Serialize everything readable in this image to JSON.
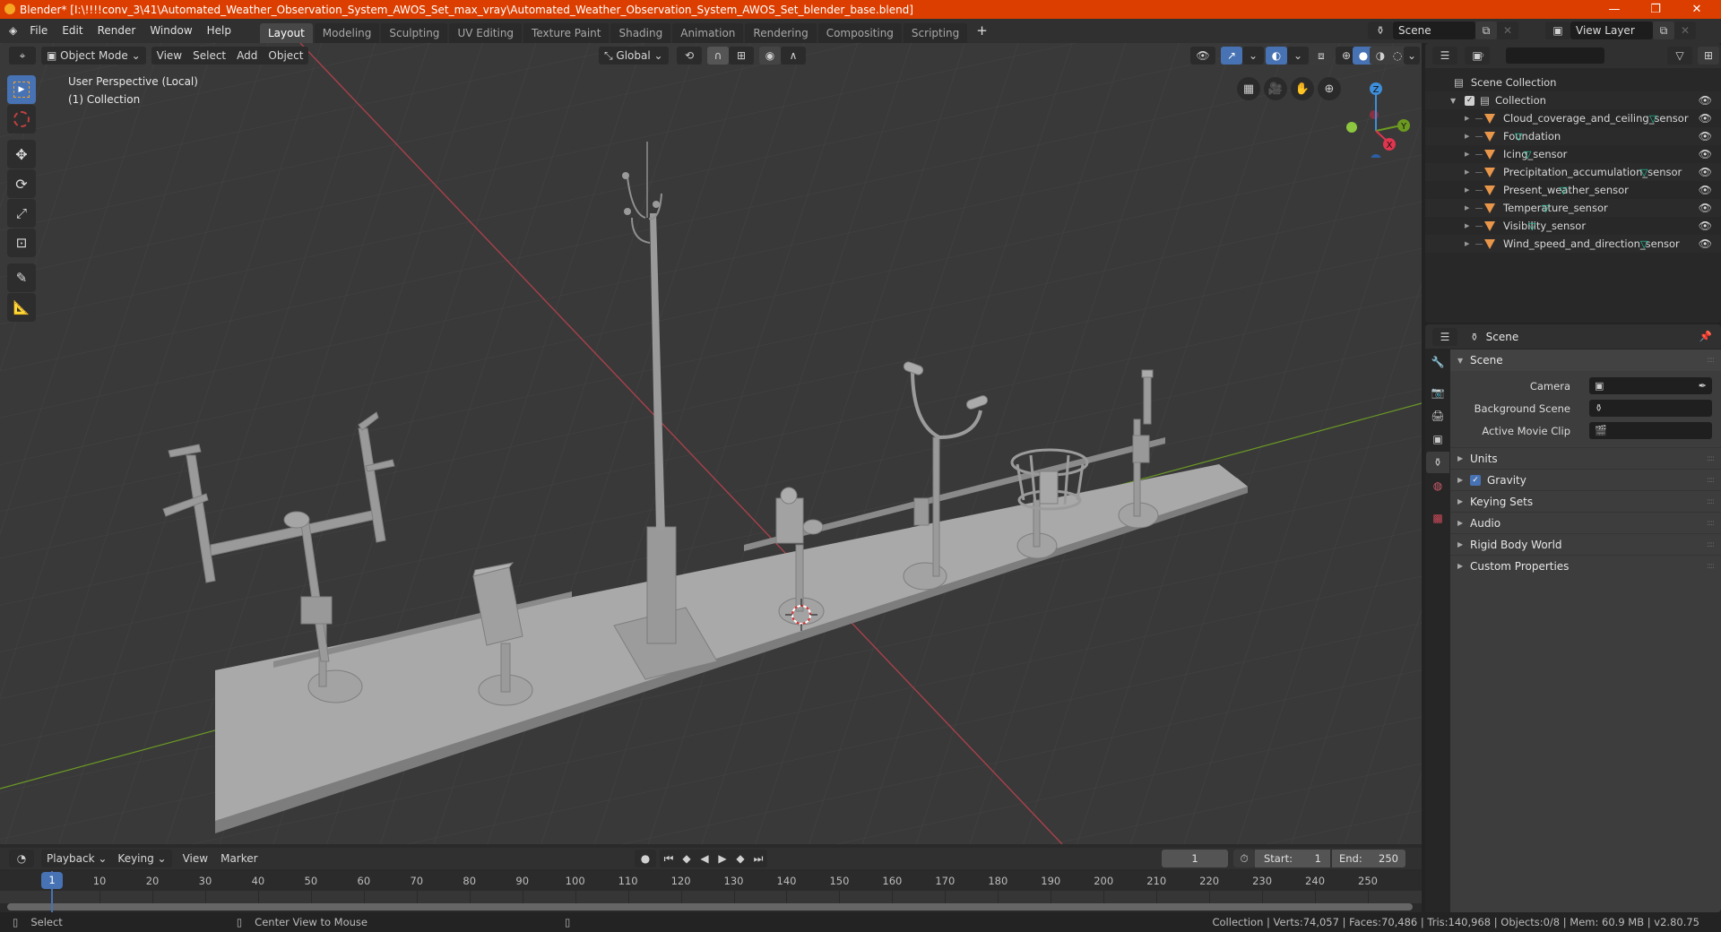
{
  "window": {
    "title": "Blender* [I:\\!!!!conv_3\\41\\Automated_Weather_Observation_System_AWOS_Set_max_vray\\Automated_Weather_Observation_System_AWOS_Set_blender_base.blend]",
    "controls": {
      "minimize": "—",
      "maximize": "❐",
      "close": "✕"
    },
    "accent_color": "#dc3e00"
  },
  "menubar": {
    "menus": [
      "File",
      "Edit",
      "Render",
      "Window",
      "Help"
    ],
    "workspaces": [
      "Layout",
      "Modeling",
      "Sculpting",
      "UV Editing",
      "Texture Paint",
      "Shading",
      "Animation",
      "Rendering",
      "Compositing",
      "Scripting"
    ],
    "active_workspace": "Layout",
    "add_workspace": "+",
    "scene": "Scene",
    "view_layer": "View Layer"
  },
  "viewport": {
    "mode": "Object Mode",
    "menus": [
      "View",
      "Select",
      "Add",
      "Object"
    ],
    "transform_orientation": "Global",
    "overlay_title": "User Perspective (Local)",
    "overlay_collection": "(1) Collection",
    "gizmo_axes": {
      "z": "Z",
      "y": "Y",
      "x": "X"
    },
    "tools": [
      "select-box",
      "cursor",
      "move",
      "rotate",
      "scale",
      "transform",
      "annotate",
      "measure"
    ],
    "active_tool": "select-box"
  },
  "outliner": {
    "search_placeholder": "",
    "root": "Scene Collection",
    "collection": "Collection",
    "collection_checked": true,
    "objects": [
      {
        "name": "Cloud_coverage_and_ceiling_sensor"
      },
      {
        "name": "Foundation"
      },
      {
        "name": "Icing_sensor"
      },
      {
        "name": "Precipitation_accumulation_sensor"
      },
      {
        "name": "Present_weather_sensor"
      },
      {
        "name": "Temperature_sensor"
      },
      {
        "name": "Visibility_sensor"
      },
      {
        "name": "Wind_speed_and_direction_sensor"
      }
    ]
  },
  "properties": {
    "context": "Scene",
    "panel_title": "Scene",
    "fields": [
      {
        "label": "Camera",
        "value": ""
      },
      {
        "label": "Background Scene",
        "value": ""
      },
      {
        "label": "Active Movie Clip",
        "value": ""
      }
    ],
    "subpanels": [
      {
        "label": "Units"
      },
      {
        "label": "Gravity",
        "checkbox": true
      },
      {
        "label": "Keying Sets"
      },
      {
        "label": "Audio"
      },
      {
        "label": "Rigid Body World"
      },
      {
        "label": "Custom Properties"
      }
    ]
  },
  "timeline": {
    "menus": [
      "Playback",
      "Keying",
      "View",
      "Marker"
    ],
    "current_frame": "1",
    "start_label": "Start:",
    "start": "1",
    "end_label": "End:",
    "end": "250",
    "ticks": [
      "10",
      "20",
      "30",
      "40",
      "50",
      "60",
      "70",
      "80",
      "90",
      "100",
      "110",
      "120",
      "130",
      "140",
      "150",
      "160",
      "170",
      "180",
      "190",
      "200",
      "210",
      "220",
      "230",
      "240",
      "250"
    ],
    "playhead": "1"
  },
  "statusbar": {
    "left_action": "Select",
    "middle_action": "Center View to Mouse",
    "stats": "Collection | Verts:74,057 | Faces:70,486 | Tris:140,968 | Objects:0/8 | Mem: 60.9 MB | v2.80.75"
  }
}
